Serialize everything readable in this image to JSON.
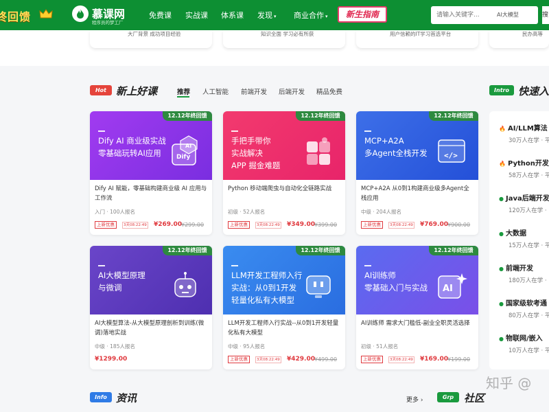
{
  "header": {
    "promo_text": "终回馈",
    "logo_name": "慕课网",
    "logo_sub": "程序员的梦工厂",
    "nav": [
      "免费课",
      "实战课",
      "体系课",
      "发现",
      "商业合作"
    ],
    "guide_badge": "新生指南",
    "search_placeholder": "请输入关键字...",
    "search_tag": "AI大模型",
    "search_btn": "搜"
  },
  "strip": [
    "大厂背景 成功项目经验",
    "知识全面 学习必有所获",
    "用户信赖的IT学习首选平台",
    "民办高等"
  ],
  "new_courses": {
    "hot_badge": "Hot",
    "title": "新上好课",
    "tabs": [
      "推荐",
      "人工智能",
      "前端开发",
      "后端开发",
      "精品免费"
    ]
  },
  "quick_entry": {
    "badge": "Intro",
    "title": "快速入"
  },
  "cards": [
    {
      "ribbon": "12.12年终回馈",
      "banner": "Dify AI 商业级实战\n零基础玩转AI应用",
      "title": "Dify AI 赋能，零基础构建商业级 AI 应用与工作流",
      "meta": "入门 · 100人报名",
      "promo": "上新优惠",
      "time": "3天08:22:49",
      "price": "¥269.00",
      "old": "¥299.00",
      "c1": "#a13bf0",
      "c2": "#7a2ee0",
      "illus": "dify"
    },
    {
      "ribbon": "12.12年终回馈",
      "banner": "手把手带你\n实战解决\nAPP 掘金难题",
      "title": "Python 移动端爬虫与自动化全链路实战",
      "meta": "初级 · 52人报名",
      "promo": "上新优惠",
      "time": "3天08:22:49",
      "price": "¥349.00",
      "old": "¥399.00",
      "c1": "#f23a6e",
      "c2": "#e8246a",
      "illus": "puzzle"
    },
    {
      "ribbon": "12.12年终回馈",
      "banner": "MCP+A2A\n多Agent全栈开发",
      "title": "MCP+A2A 从0到1构建商业级多Agent全栈应用",
      "meta": "中级 · 204人报名",
      "promo": "上新优惠",
      "time": "3天08:22:49",
      "price": "¥769.00",
      "old": "¥900.00",
      "c1": "#3d6fe8",
      "c2": "#2450d8",
      "illus": "code"
    },
    {
      "ribbon": "12.12年终回馈",
      "banner": "AI大模型原理\n与微调",
      "title": "AI大模型算法-从大模型原理剖析到训练(微调)落地实战",
      "meta": "中级 · 185人报名",
      "promo": "",
      "time": "",
      "price": "¥1299.00",
      "old": "",
      "c1": "#6a45c9",
      "c2": "#4e2fb0",
      "illus": "robot"
    },
    {
      "ribbon": "12.12年终回馈",
      "banner": "LLM开发工程师入行\n实战：从0到1开发\n轻量化私有大模型",
      "title": "LLM开发工程师入行实战--从0到1开发轻量化私有大模型",
      "meta": "中级 · 95人报名",
      "promo": "上新优惠",
      "time": "3天08:22:49",
      "price": "¥429.00",
      "old": "¥499.00",
      "c1": "#3a8cf0",
      "c2": "#2a6de0",
      "illus": "screen"
    },
    {
      "ribbon": "12.12年终回馈",
      "banner": "AI训练师\n零基础入门与实战",
      "title": "AI训练师 需求大门槛低-副业全职灵活选择",
      "meta": "初级 · 51人报名",
      "promo": "上新优惠",
      "time": "3天08:22:49",
      "price": "¥169.00",
      "old": "¥199.00",
      "c1": "#5a6bf0",
      "c2": "#7a4fe8",
      "illus": "ai"
    }
  ],
  "quick_items": [
    {
      "icon": "🔥",
      "color": "#e5443b",
      "name": "AI/LLM算法",
      "sub": "30万人在学 · 平"
    },
    {
      "icon": "🔥",
      "color": "#e5443b",
      "name": "Python开发",
      "sub": "58万人在学 · 平"
    },
    {
      "icon": "●",
      "color": "#1a9a3e",
      "name": "Java后端开发",
      "sub": "120万人在学 · "
    },
    {
      "icon": "●",
      "color": "#1a9a3e",
      "name": "大数据",
      "sub": "15万人在学 · 平"
    },
    {
      "icon": "●",
      "color": "#1a9a3e",
      "name": "前端开发",
      "sub": "180万人在学 · "
    },
    {
      "icon": "●",
      "color": "#1a9a3e",
      "name": "国家级软考通",
      "sub": "80万人在学 · 平"
    },
    {
      "icon": "●",
      "color": "#1a9a3e",
      "name": "物联网/嵌入",
      "sub": "10万人在学 · 平"
    }
  ],
  "bottom": {
    "info_badge": "Info",
    "info_title": "资讯",
    "more": "更多",
    "grp_badge": "Grp",
    "grp_title": "社区"
  },
  "watermark": "知乎 @"
}
